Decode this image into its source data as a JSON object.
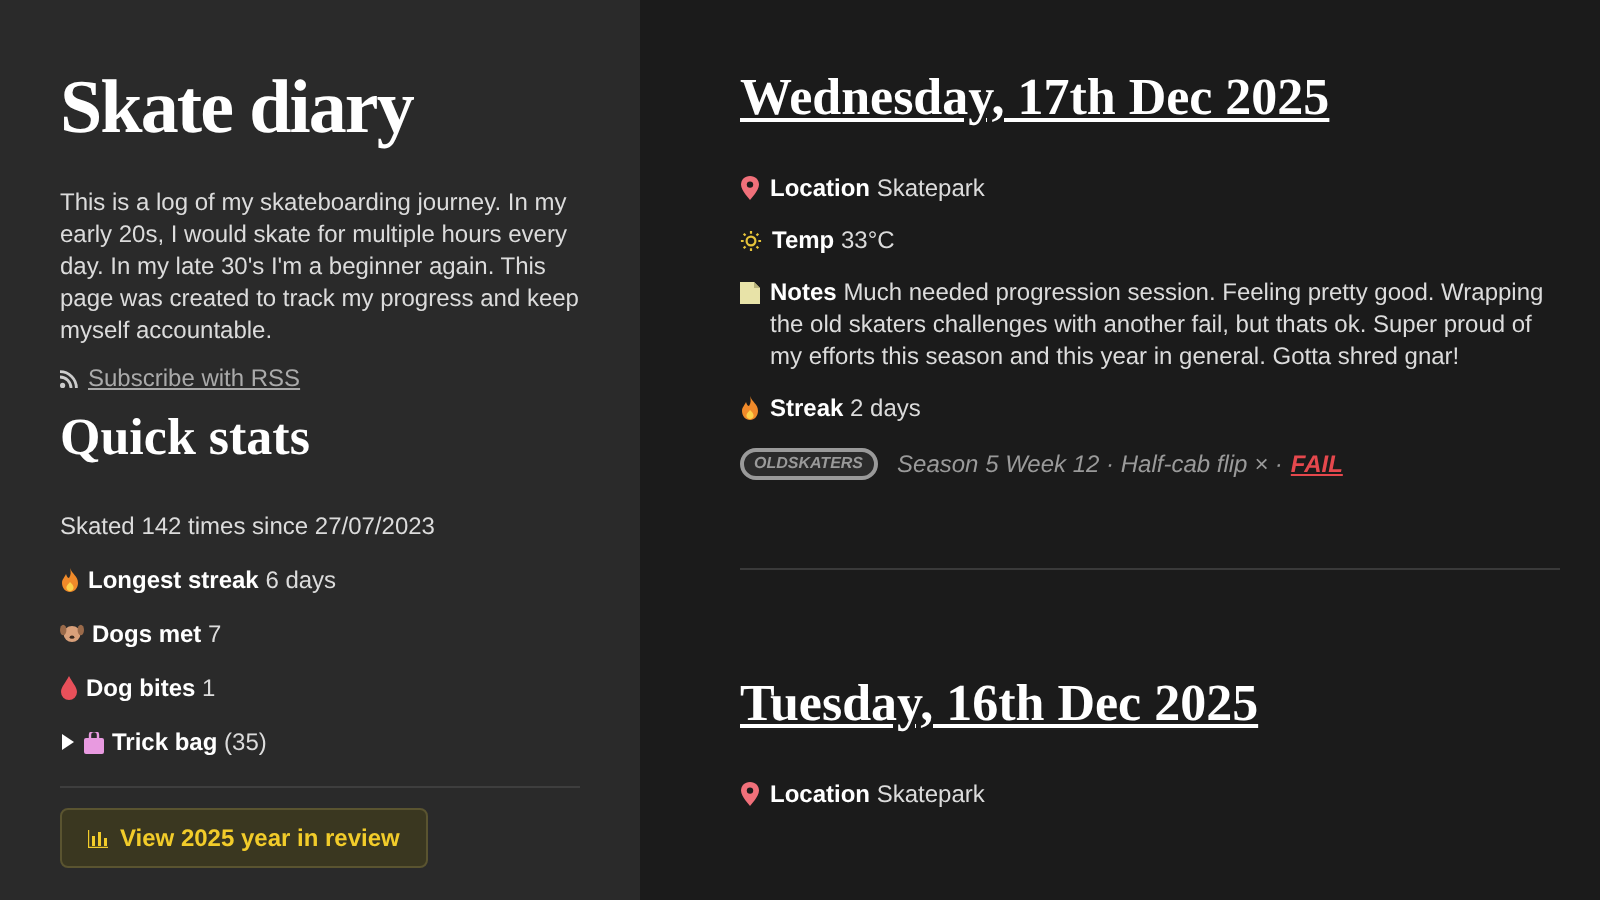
{
  "sidebar": {
    "title": "Skate diary",
    "intro": "This is a log of my skateboarding journey. In my early 20s, I would skate for multiple hours every day. In my late 30's I'm a beginner again. This page was created to track my progress and keep myself accountable.",
    "rss_link": "Subscribe with RSS",
    "stats_title": "Quick stats",
    "summary": "Skated 142 times since 27/07/2023",
    "stats": [
      {
        "kind": "streak",
        "label": "Longest streak",
        "value": "6 days"
      },
      {
        "kind": "dog",
        "label": "Dogs met",
        "value": "7"
      },
      {
        "kind": "blood",
        "label": "Dog bites",
        "value": "1"
      }
    ],
    "trick_bag": {
      "label": "Trick bag",
      "count": "(35)",
      "expanded": false
    },
    "review_button": "View 2025 year in review"
  },
  "entries": [
    {
      "date": "Wednesday, 17th Dec 2025",
      "details": [
        {
          "kind": "location",
          "label": "Location",
          "value": "Skatepark"
        },
        {
          "kind": "temp",
          "label": "Temp",
          "value": "33°C"
        },
        {
          "kind": "notes",
          "label": "Notes",
          "value": "Much needed progression session. Feeling pretty good. Wrapping the old skaters challenges with another fail, but thats ok. Super proud of my efforts this season and this year in general. Gotta shred gnar!"
        },
        {
          "kind": "streak",
          "label": "Streak",
          "value": "2 days"
        }
      ],
      "challenge": {
        "badge": "OLDSKATERS",
        "text": "Season 5 Week 12 · Half-cab flip × ·",
        "result": "FAIL"
      }
    },
    {
      "date": "Tuesday, 16th Dec 2025",
      "details": [
        {
          "kind": "location",
          "label": "Location",
          "value": "Skatepark"
        }
      ]
    }
  ]
}
